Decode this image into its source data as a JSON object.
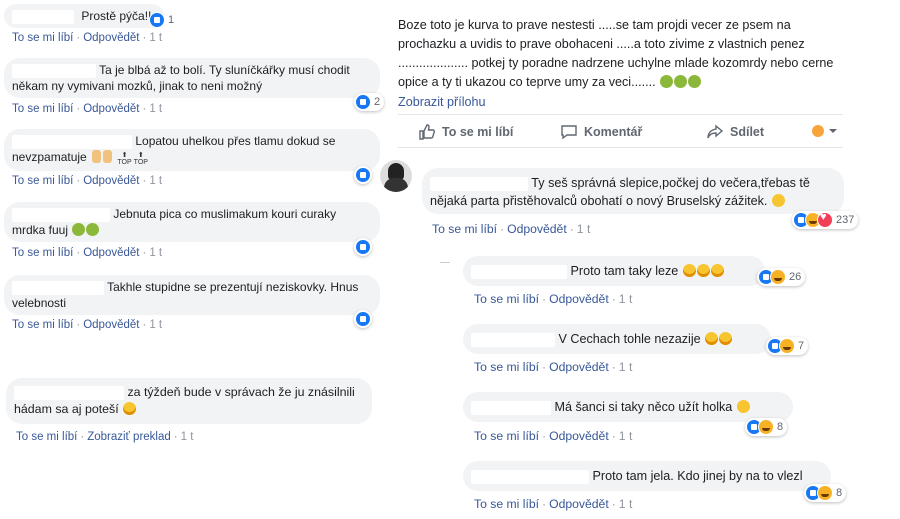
{
  "left_comments": [
    {
      "text": "Prostě pýča!!",
      "like": "To se mi líbí",
      "reply": "Odpovědět",
      "time": "1 t",
      "count": "1"
    },
    {
      "text": "Ta je blbá až to bolí. Ty sluníčkářky musí chodit někam ny vymivani mozků, jinak to neni možný",
      "like": "To se mi líbí",
      "reply": "Odpovědět",
      "time": "1 t",
      "count": "2"
    },
    {
      "text": "Lopatou uhelkou přes tlamu dokud se nevzpamatuje",
      "like": "To se mi líbí",
      "reply": "Odpovědět",
      "time": "1 t",
      "count": ""
    },
    {
      "text": "Jebnuta pica co muslimakum kouri curaky mrdka fuuj",
      "like": "To se mi líbí",
      "reply": "Odpovědět",
      "time": "1 t",
      "count": ""
    },
    {
      "text": "Takhle stupidne se prezentují neziskovky. Hnus velebnosti",
      "like": "To se mi líbí",
      "reply": "Odpovědět",
      "time": "1 t",
      "count": ""
    },
    {
      "text": "za týždeň bude v správach že ju znásilnili hádam sa aj poteší",
      "like": "To se mi líbí",
      "reply": "Zobraziť preklad",
      "time": "1 t",
      "count": ""
    }
  ],
  "top_labels": {
    "top": "TOP"
  },
  "post": {
    "text": "Boze toto je kurva to prave nestesti .....se tam projdi vecer ze psem na prochazku a uvidis to prave obohaceni .....a toto zivime z vlastnich penez .................... potkej ty poradne nadrzene uchylne mlade kozomrdy nebo cerne opice a ty ti ukazou co teprve umy za veci.......",
    "attachment_link": "Zobrazit přílohu",
    "action_like": "To se mi líbí",
    "action_comment": "Komentář",
    "action_share": "Sdílet"
  },
  "right_comments": [
    {
      "text": "Ty seš správná slepice,počkej do večera,třebas tě nějaká parta přistěhovalců obohatí o nový Bruselský zážitek.",
      "like": "To se mi líbí",
      "reply": "Odpovědět",
      "time": "1 t",
      "count": "237"
    },
    {
      "text": "Proto tam taky leze",
      "like": "To se mi líbí",
      "reply": "Odpovědět",
      "time": "1 t",
      "count": "26"
    },
    {
      "text": "V Cechach tohle nezazije",
      "like": "To se mi líbí",
      "reply": "Odpovědět",
      "time": "1 t",
      "count": "7"
    },
    {
      "text": "Má šanci si taky něco užít holka",
      "like": "To se mi líbí",
      "reply": "Odpovědět",
      "time": "1 t",
      "count": "8"
    },
    {
      "text": "Proto tam jela. Kdo jinej by na to vlezl",
      "like": "To se mi líbí",
      "reply": "Odpovědět",
      "time": "1 t",
      "count": "8"
    }
  ],
  "colors": {
    "link": "#385898",
    "bubble": "#f2f3f5",
    "like": "#1877f2"
  }
}
